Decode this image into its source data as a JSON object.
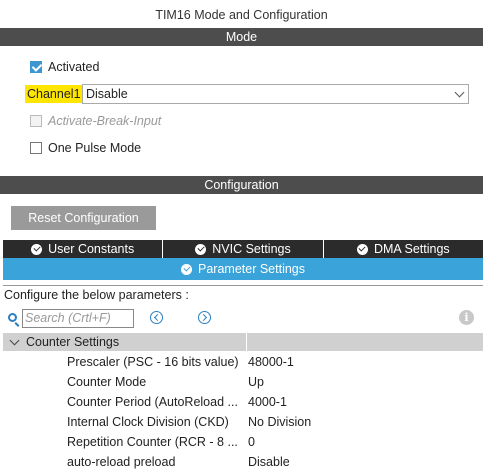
{
  "window": {
    "title": "TIM16 Mode and Configuration"
  },
  "mode_section": {
    "header": "Mode",
    "activated": {
      "label": "Activated",
      "checked": true
    },
    "channel1": {
      "label": "Channel1",
      "value": "Disable"
    },
    "activate_break_input": {
      "label": "Activate-Break-Input",
      "checked": false,
      "disabled": true
    },
    "one_pulse_mode": {
      "label": "One Pulse Mode",
      "checked": false
    }
  },
  "config_section": {
    "header": "Configuration",
    "reset_button": "Reset Configuration",
    "tabs": [
      {
        "label": "User Constants",
        "icon": "check-circle-icon"
      },
      {
        "label": "NVIC Settings",
        "icon": "check-circle-icon"
      },
      {
        "label": "DMA Settings",
        "icon": "check-circle-icon"
      }
    ],
    "active_tab": {
      "label": "Parameter Settings",
      "icon": "check-circle-icon"
    },
    "configure_text": "Configure the below parameters :",
    "search": {
      "placeholder": "Search (Crtl+F)"
    },
    "group": {
      "label": "Counter Settings",
      "params": [
        {
          "name": "Prescaler (PSC - 16 bits value)",
          "value": "48000-1"
        },
        {
          "name": "Counter Mode",
          "value": "Up"
        },
        {
          "name": "Counter Period (AutoReload ...",
          "value": "4000-1"
        },
        {
          "name": "Internal Clock Division (CKD)",
          "value": "No Division"
        },
        {
          "name": "Repetition Counter (RCR - 8 ...",
          "value": "0"
        },
        {
          "name": "auto-reload preload",
          "value": "Disable"
        }
      ]
    }
  },
  "colors": {
    "band": "#4d4d4d",
    "tab_dark": "#2b2b2b",
    "tab_active": "#3aa3d9",
    "highlight": "#ffe600",
    "checkbox": "#3c97d1"
  }
}
